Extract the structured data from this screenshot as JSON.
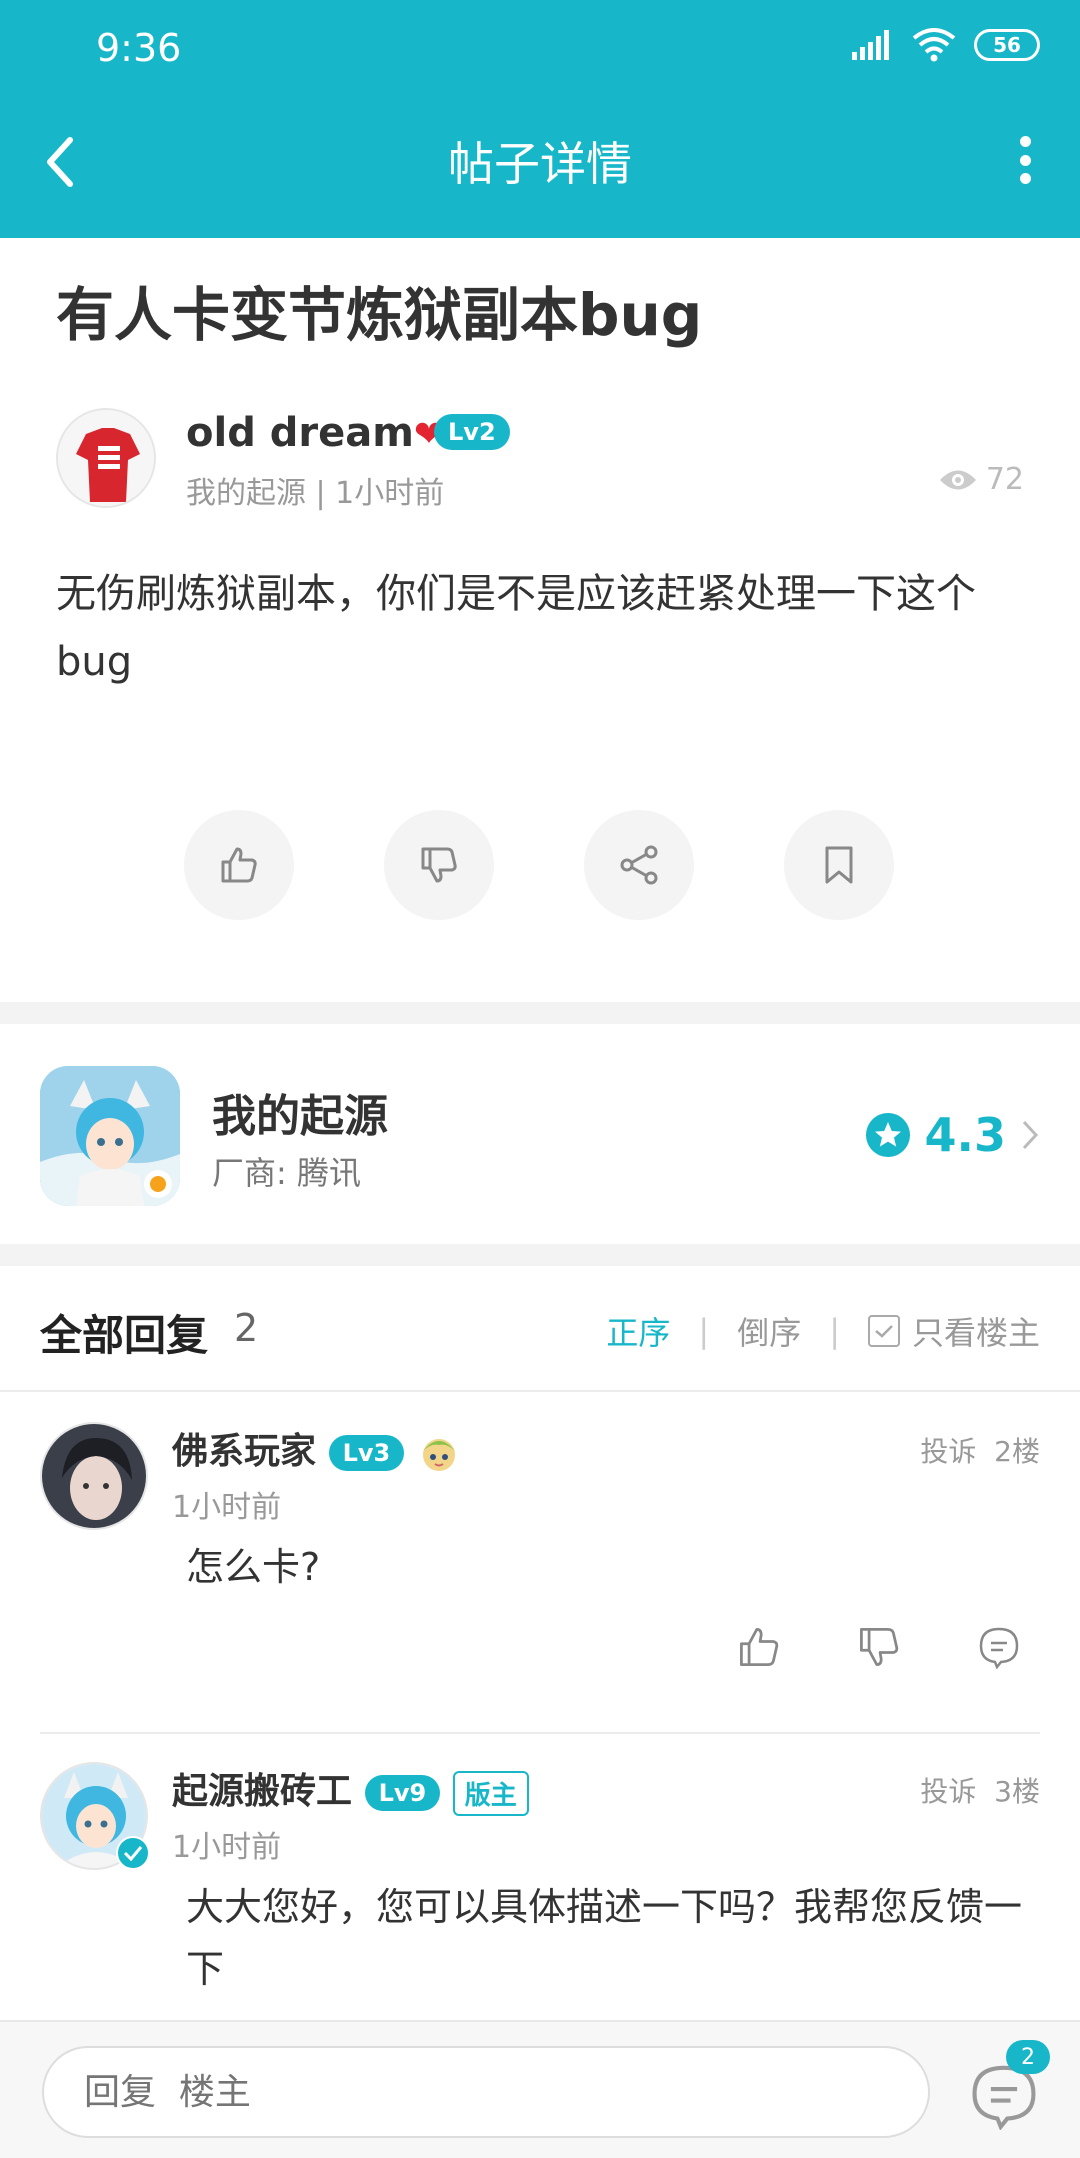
{
  "status_bar": {
    "time": "9:36",
    "battery": "56"
  },
  "app_bar": {
    "title": "帖子详情"
  },
  "post": {
    "title": "有人卡变节炼狱副本bug",
    "author": {
      "name": "old dream",
      "level": "Lv2"
    },
    "meta": "我的起源 | 1小时前",
    "views": "72",
    "body": "无伤刷炼狱副本，你们是不是应该赶紧处理一下这个bug"
  },
  "game": {
    "name": "我的起源",
    "vendor": "厂商: 腾讯",
    "rating": "4.3"
  },
  "replies": {
    "title": "全部回复",
    "count": "2",
    "sort": {
      "asc": "正序",
      "desc": "倒序",
      "author_only": "只看楼主"
    },
    "items": [
      {
        "name": "佛系玩家",
        "level": "Lv3",
        "time": "1小时前",
        "report": "投诉",
        "floor": "2楼",
        "content": "怎么卡?"
      },
      {
        "name": "起源搬砖工",
        "level": "Lv9",
        "tag": "版主",
        "time": "1小时前",
        "report": "投诉",
        "floor": "3楼",
        "content": "大大您好，您可以具体描述一下吗？我帮您反馈一下"
      }
    ]
  },
  "bottom_bar": {
    "placeholder": "回复  楼主",
    "badge": "2"
  },
  "colors": {
    "accent": "#17b7c9",
    "heart": "#e32431"
  }
}
